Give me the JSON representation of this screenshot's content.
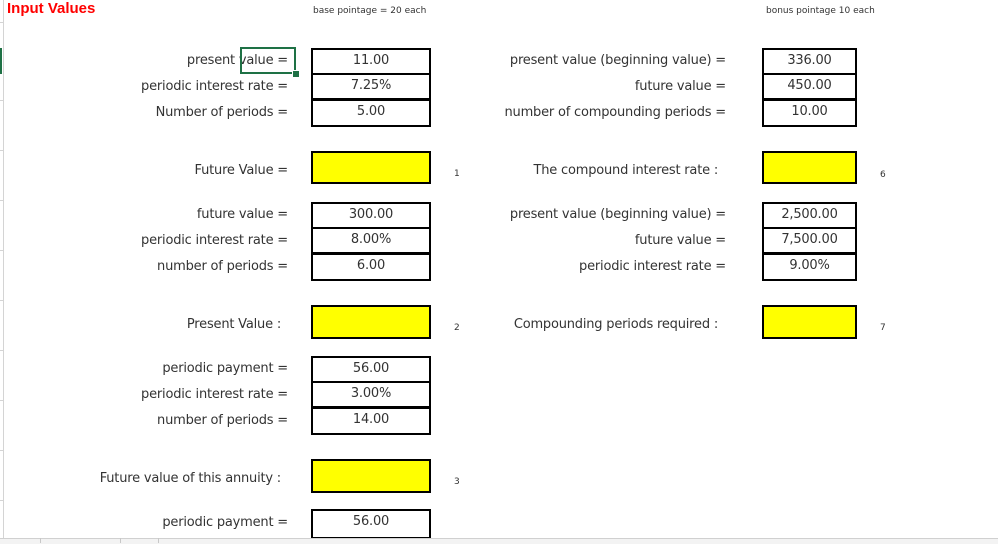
{
  "sheet": {
    "title": "Input Values",
    "base_note": "base pointage = 20 each",
    "bonus_note": "bonus pointage 10 each",
    "active_cell_label": "present value ="
  },
  "left_sections": [
    {
      "inputs": [
        {
          "label": "present value =",
          "value": "11.00"
        },
        {
          "label": "periodic interest rate =",
          "value": "7.25%"
        },
        {
          "label": "Number of periods =",
          "value": "5.00"
        }
      ],
      "result_label": "Future Value =",
      "result_value": "",
      "index": "1"
    },
    {
      "inputs": [
        {
          "label": "future value =",
          "value": "300.00"
        },
        {
          "label": "periodic interest rate =",
          "value": "8.00%"
        },
        {
          "label": "number of  periods =",
          "value": "6.00"
        }
      ],
      "result_label": "Present Value :",
      "result_value": "",
      "index": "2"
    },
    {
      "inputs": [
        {
          "label": "periodic payment =",
          "value": "56.00"
        },
        {
          "label": "periodic interest rate =",
          "value": "3.00%"
        },
        {
          "label": "number of  periods =",
          "value": "14.00"
        }
      ],
      "result_label": "Future value of this annuity :",
      "result_value": "",
      "index": "3"
    },
    {
      "inputs": [
        {
          "label": "periodic payment =",
          "value": "56.00"
        }
      ]
    }
  ],
  "right_sections": [
    {
      "inputs": [
        {
          "label": "present value (beginning value) =",
          "value": "336.00"
        },
        {
          "label": "future value =",
          "value": "450.00"
        },
        {
          "label": "number of compounding periods =",
          "value": "10.00"
        }
      ],
      "result_label": "The compound interest rate :",
      "result_value": "",
      "index": "6"
    },
    {
      "inputs": [
        {
          "label": "present value (beginning value) =",
          "value": "2,500.00"
        },
        {
          "label": "future value =",
          "value": "7,500.00"
        },
        {
          "label": "periodic interest rate =",
          "value": "9.00%"
        }
      ],
      "result_label": "Compounding periods required :",
      "result_value": "",
      "index": "7"
    }
  ],
  "colors": {
    "title": "#ff0000",
    "answer_fill": "#ffff00",
    "selection": "#1e7145"
  }
}
